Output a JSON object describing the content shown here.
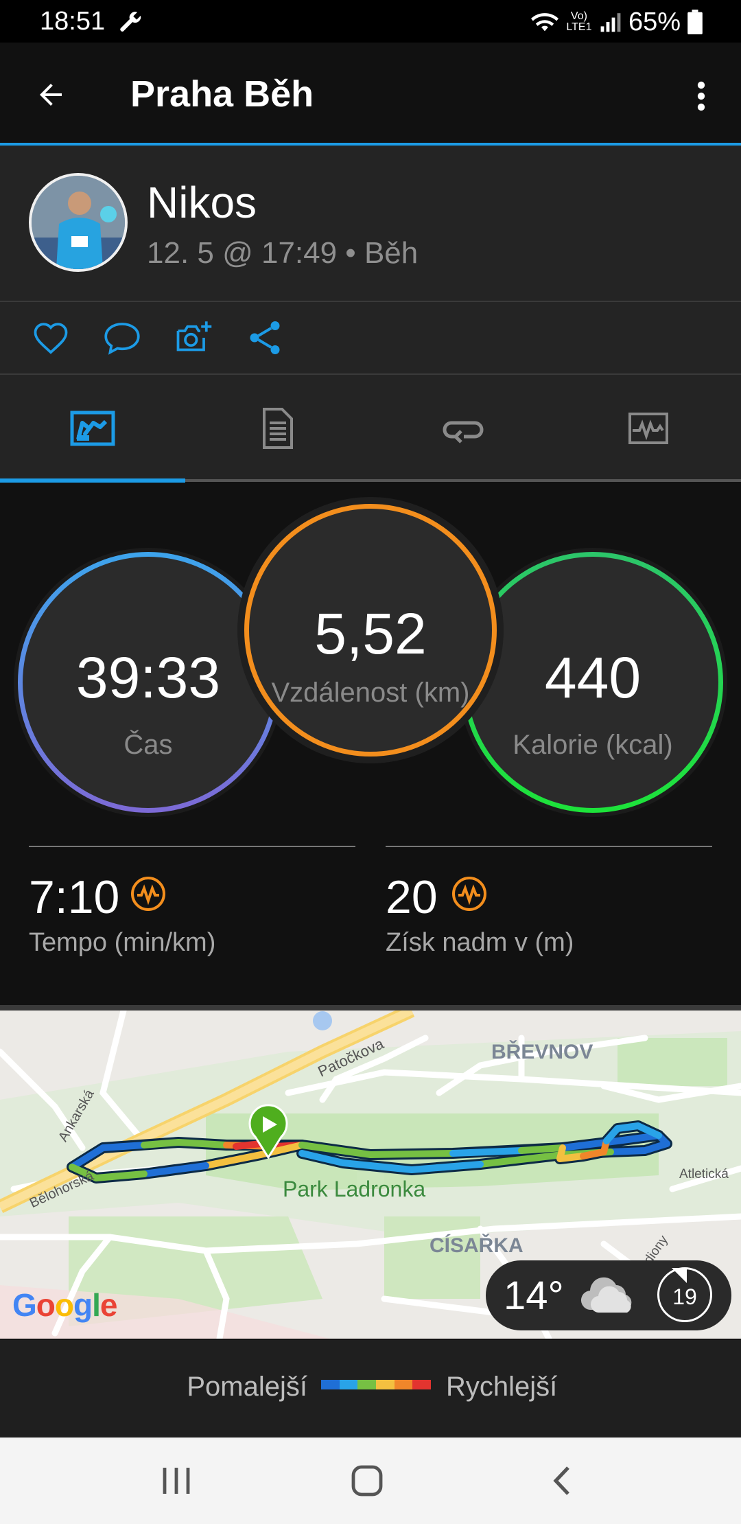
{
  "status_bar": {
    "time": "18:51",
    "battery_text": "65%",
    "network_label": "Vo) LTE1",
    "icons": [
      "wrench-icon",
      "wifi-icon",
      "volte-icon",
      "signal-icon",
      "battery-icon"
    ]
  },
  "app_bar": {
    "title": "Praha Běh",
    "back_icon": "arrow-left-icon",
    "menu_icon": "overflow-menu-icon"
  },
  "profile": {
    "name": "Nikos",
    "meta": "12. 5 @ 17:49 • Běh"
  },
  "actions": [
    "like-icon",
    "comment-icon",
    "add-photo-icon",
    "share-icon"
  ],
  "tabs": [
    {
      "icon": "summary-icon",
      "selected": true
    },
    {
      "icon": "details-icon",
      "selected": false
    },
    {
      "icon": "laps-icon",
      "selected": false
    },
    {
      "icon": "charts-icon",
      "selected": false
    }
  ],
  "stats": {
    "time": {
      "value": "39:33",
      "label": "Čas"
    },
    "distance": {
      "value": "5,52",
      "label": "Vzdálenost (km)"
    },
    "calories": {
      "value": "440",
      "label": "Kalorie (kcal)"
    },
    "pace": {
      "value": "7:10",
      "label": "Tempo (min/km)"
    },
    "elevation": {
      "value": "20",
      "label": "Získ nadm v (m)"
    }
  },
  "map": {
    "labels": {
      "brevnov": "BŘEVNOV",
      "patockova": "Patočkova",
      "ankarska": "Ankarská",
      "belohorska": "Bělohorská",
      "park": "Park Ladronka",
      "cisarka": "CÍSAŘKA",
      "atleticka": "Atletická",
      "diony": "diony"
    },
    "weather": {
      "temp": "14°",
      "icon": "cloud-icon",
      "wind": "19"
    },
    "attribution": "Google"
  },
  "legend": {
    "slower": "Pomalejší",
    "faster": "Rychlejší",
    "colors": [
      "#1f6fd6",
      "#29a3e8",
      "#76c043",
      "#f3c040",
      "#f0862a",
      "#e3342f"
    ]
  },
  "nav_bar": [
    "recents-icon",
    "home-icon",
    "back-icon"
  ],
  "colors": {
    "accent": "#1c9be6",
    "distance_ring": "#f38e1d",
    "calorie_ring": "#1de33a",
    "time_ring": "#3da4ec"
  }
}
